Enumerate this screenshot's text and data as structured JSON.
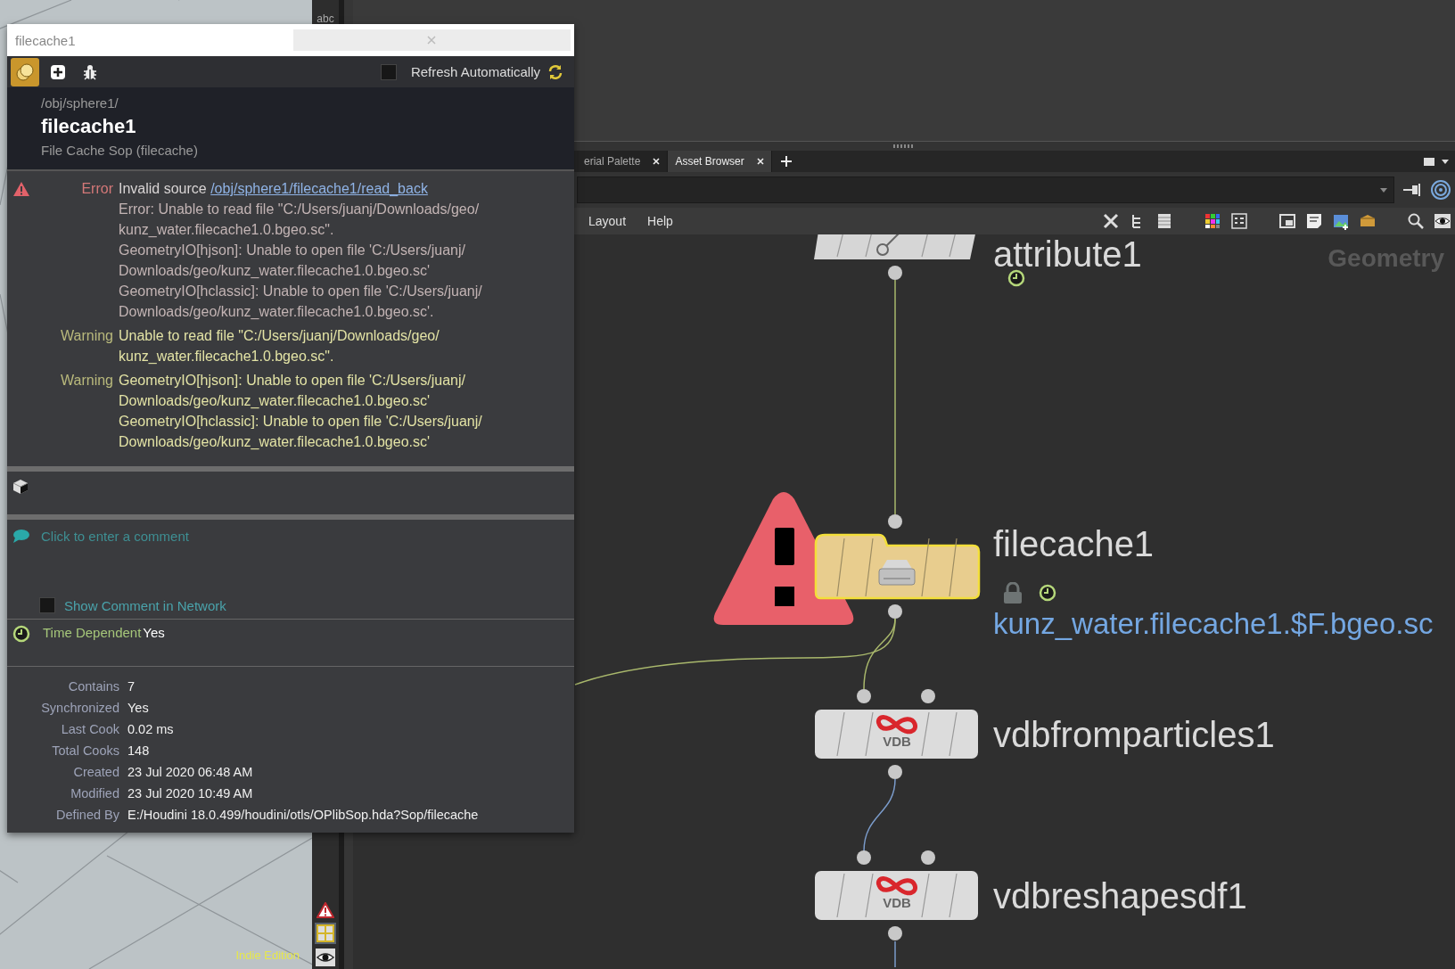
{
  "viewport": {
    "edition_label": "Indie Edition"
  },
  "tool_strip": {
    "label": "abc"
  },
  "network": {
    "tabs": [
      {
        "label": "erial Palette",
        "selected": false
      },
      {
        "label": "Asset Browser",
        "selected": true
      }
    ],
    "menu": [
      "Layout",
      "Help"
    ],
    "context_label": "Geometry",
    "nodes": [
      {
        "kind": "attribute",
        "name": "attribute1",
        "selected": false,
        "error": false,
        "locked": false,
        "time_dependent": true
      },
      {
        "kind": "filecache",
        "name": "filecache1",
        "selected": true,
        "error": true,
        "locked": true,
        "time_dependent": true,
        "output_file": "kunz_water.filecache1.$F.bgeo.sc"
      },
      {
        "kind": "vdb",
        "name": "vdbfromparticles1",
        "icon_text": "VDB",
        "selected": false,
        "error": false,
        "locked": false,
        "time_dependent": false
      },
      {
        "kind": "vdb",
        "name": "vdbreshapesdf1",
        "icon_text": "VDB",
        "selected": false,
        "error": false,
        "locked": false,
        "time_dependent": false
      }
    ]
  },
  "popup": {
    "title": "filecache1",
    "refresh": {
      "label": "Refresh Automatically",
      "checked": false
    },
    "path": "/obj/sphere1/",
    "name": "filecache1",
    "type": "File Cache Sop (filecache)",
    "messages": [
      {
        "kind": "error",
        "label": "Error",
        "text": "Invalid source ",
        "link": "/obj/sphere1/filecache1/read_back",
        "lines": [
          "Error: Unable to read file \"C:/Users/juanj/Downloads/geo/",
          "kunz_water.filecache1.0.bgeo.sc\".",
          "GeometryIO[hjson]: Unable to open file 'C:/Users/juanj/",
          "Downloads/geo/kunz_water.filecache1.0.bgeo.sc'",
          "GeometryIO[hclassic]: Unable to open file 'C:/Users/juanj/",
          "Downloads/geo/kunz_water.filecache1.0.bgeo.sc'."
        ]
      },
      {
        "kind": "warning",
        "label": "Warning",
        "lines": [
          "Unable to read file \"C:/Users/juanj/Downloads/geo/",
          "kunz_water.filecache1.0.bgeo.sc\"."
        ]
      },
      {
        "kind": "warning",
        "label": "Warning",
        "lines": [
          "GeometryIO[hjson]: Unable to open file 'C:/Users/juanj/",
          "Downloads/geo/kunz_water.filecache1.0.bgeo.sc'",
          "GeometryIO[hclassic]: Unable to open file 'C:/Users/juanj/",
          "Downloads/geo/kunz_water.filecache1.0.bgeo.sc'"
        ]
      }
    ],
    "comment": {
      "placeholder": "Click to enter a comment",
      "show_label": "Show Comment in Network",
      "show_checked": false
    },
    "time_dependent": {
      "label": "Time Dependent",
      "value": "Yes"
    },
    "stats": [
      {
        "label": "Contains",
        "value": "7"
      },
      {
        "label": "Synchronized",
        "value": "Yes"
      },
      {
        "label": "Last Cook",
        "value": "0.02 ms"
      },
      {
        "label": "Total Cooks",
        "value": "148"
      },
      {
        "label": "Created",
        "value": "23 Jul 2020 06:48 AM"
      },
      {
        "label": "Modified",
        "value": "23 Jul 2020 10:49 AM"
      },
      {
        "label": "Defined By",
        "value": "E:/Houdini 18.0.499/houdini/otls/OPlibSop.hda?Sop/filecache"
      }
    ]
  }
}
